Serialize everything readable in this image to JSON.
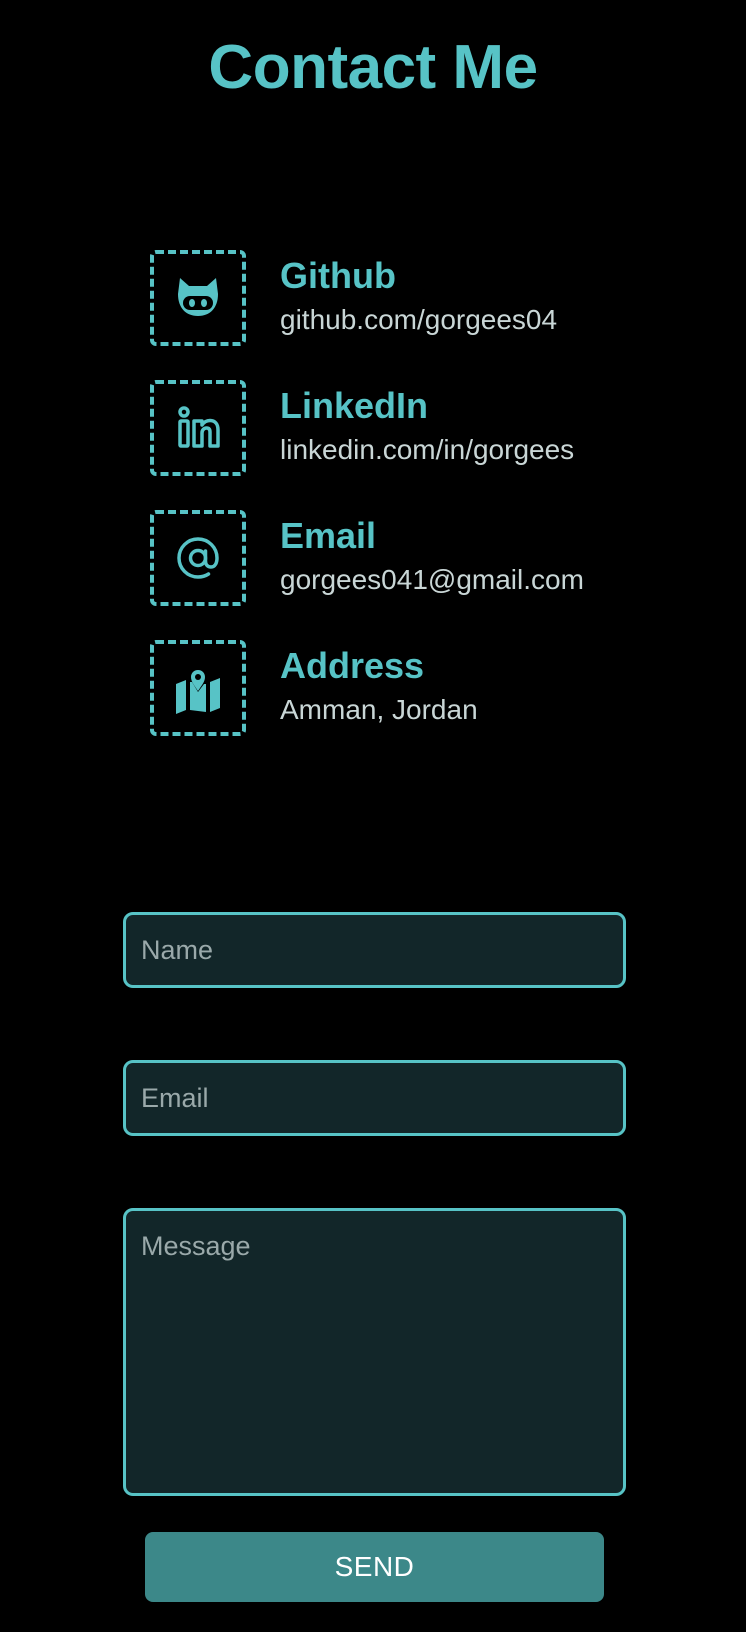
{
  "page": {
    "title": "Contact Me"
  },
  "contacts": [
    {
      "icon": "github-icon",
      "label": "Github",
      "value": "github.com/gorgees04"
    },
    {
      "icon": "linkedin-icon",
      "label": "LinkedIn",
      "value": "linkedin.com/in/gorgees"
    },
    {
      "icon": "at-sign-icon",
      "label": "Email",
      "value": "gorgees041@gmail.com"
    },
    {
      "icon": "map-pin-icon",
      "label": "Address",
      "value": "Amman, Jordan"
    }
  ],
  "form": {
    "name_placeholder": "Name",
    "email_placeholder": "Email",
    "message_placeholder": "Message",
    "send_label": "SEND"
  },
  "colors": {
    "background": "#000000",
    "accent": "#57c3c6",
    "field_background": "#122629",
    "button_background": "#3c8889",
    "text_secondary": "#c9d6d6"
  }
}
